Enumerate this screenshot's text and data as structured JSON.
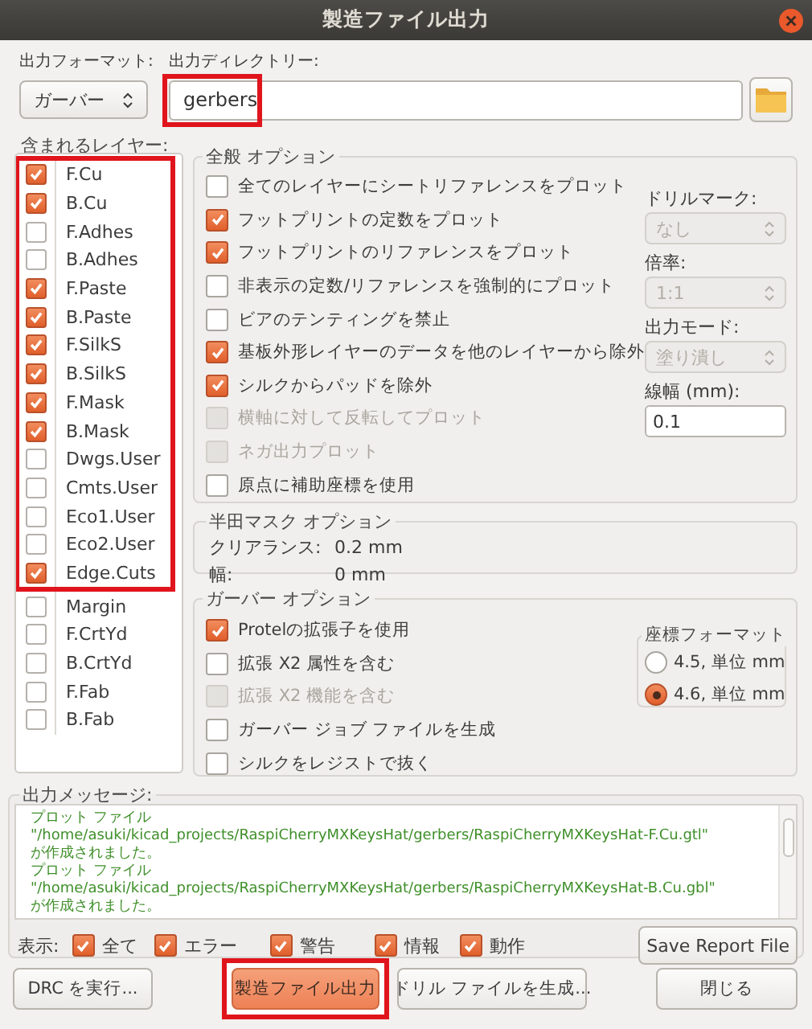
{
  "window": {
    "title": "製造ファイル出力"
  },
  "output_format": {
    "label": "出力フォーマット:",
    "value": "ガーバー"
  },
  "output_directory": {
    "label": "出力ディレクトリー:",
    "value": "gerbers",
    "highlighted": true
  },
  "layers": {
    "label": "含まれるレイヤー:",
    "groups": [
      {
        "highlighted": true,
        "items": [
          {
            "name": "F.Cu",
            "checked": true
          },
          {
            "name": "B.Cu",
            "checked": true
          },
          {
            "name": "F.Adhes",
            "checked": false
          },
          {
            "name": "B.Adhes",
            "checked": false
          },
          {
            "name": "F.Paste",
            "checked": true
          },
          {
            "name": "B.Paste",
            "checked": true
          },
          {
            "name": "F.SilkS",
            "checked": true
          },
          {
            "name": "B.SilkS",
            "checked": true
          },
          {
            "name": "F.Mask",
            "checked": true
          },
          {
            "name": "B.Mask",
            "checked": true
          },
          {
            "name": "Dwgs.User",
            "checked": false
          },
          {
            "name": "Cmts.User",
            "checked": false
          },
          {
            "name": "Eco1.User",
            "checked": false
          },
          {
            "name": "Eco2.User",
            "checked": false
          },
          {
            "name": "Edge.Cuts",
            "checked": true
          }
        ]
      },
      {
        "highlighted": false,
        "items": [
          {
            "name": "Margin",
            "checked": false
          },
          {
            "name": "F.CrtYd",
            "checked": false
          },
          {
            "name": "B.CrtYd",
            "checked": false
          },
          {
            "name": "F.Fab",
            "checked": false
          },
          {
            "name": "B.Fab",
            "checked": false
          }
        ]
      }
    ]
  },
  "general_options": {
    "title": "全般 オプション",
    "options": [
      {
        "label": "全てのレイヤーにシートリファレンスをプロット",
        "checked": false,
        "disabled": false
      },
      {
        "label": "フットプリントの定数をプロット",
        "checked": true,
        "disabled": false
      },
      {
        "label": "フットプリントのリファレンスをプロット",
        "checked": true,
        "disabled": false
      },
      {
        "label": "非表示の定数/リファレンスを強制的にプロット",
        "checked": false,
        "disabled": false
      },
      {
        "label": "ビアのテンティングを禁止",
        "checked": false,
        "disabled": false
      },
      {
        "label": "基板外形レイヤーのデータを他のレイヤーから除外",
        "checked": true,
        "disabled": false
      },
      {
        "label": "シルクからパッドを除外",
        "checked": true,
        "disabled": false
      },
      {
        "label": "横軸に対して反転してプロット",
        "checked": false,
        "disabled": true
      },
      {
        "label": "ネガ出力プロット",
        "checked": false,
        "disabled": true
      },
      {
        "label": "原点に補助座標を使用",
        "checked": false,
        "disabled": false
      }
    ],
    "settings": [
      {
        "kind": "select",
        "label": "ドリルマーク:",
        "value": "なし",
        "disabled": true
      },
      {
        "kind": "select",
        "label": "倍率:",
        "value": "1:1",
        "disabled": true
      },
      {
        "kind": "select",
        "label": "出力モード:",
        "value": "塗り潰し",
        "disabled": true
      },
      {
        "kind": "input",
        "label": "線幅 (mm):",
        "value": "0.1",
        "disabled": false
      }
    ]
  },
  "solder_mask_options": {
    "title": "半田マスク オプション",
    "rows": [
      {
        "label": "クリアランス:",
        "value": "0.2 mm"
      },
      {
        "label": "幅:",
        "value": "0 mm"
      }
    ]
  },
  "gerber_options": {
    "title": "ガーバー オプション",
    "options": [
      {
        "label": "Protelの拡張子を使用",
        "checked": true,
        "disabled": false
      },
      {
        "label": "拡張 X2 属性を含む",
        "checked": false,
        "disabled": false
      },
      {
        "label": "拡張 X2 機能を含む",
        "checked": false,
        "disabled": true
      },
      {
        "label": "ガーバー ジョブ ファイルを生成",
        "checked": false,
        "disabled": false
      },
      {
        "label": "シルクをレジストで抜く",
        "checked": false,
        "disabled": false
      }
    ],
    "coordinate_format": {
      "title": "座標フォーマット",
      "choices": [
        {
          "label": "4.5, 単位 mm",
          "selected": false
        },
        {
          "label": "4.6, 単位 mm",
          "selected": true
        }
      ]
    }
  },
  "messages": {
    "label": "出力メッセージ:",
    "lines": [
      "プロット ファイル",
      "\"/home/asuki/kicad_projects/RaspiCherryMXKeysHat/gerbers/RaspiCherryMXKeysHat-F.Cu.gtl\"",
      "が作成されました。",
      "プロット ファイル",
      "\"/home/asuki/kicad_projects/RaspiCherryMXKeysHat/gerbers/RaspiCherryMXKeysHat-B.Cu.gbl\"",
      "が作成されました。"
    ]
  },
  "filters": {
    "label": "表示:",
    "items": [
      {
        "label": "全て",
        "checked": true
      },
      {
        "label": "エラー",
        "checked": true
      },
      {
        "label": "警告",
        "checked": true
      },
      {
        "label": "情報",
        "checked": true
      },
      {
        "label": "動作",
        "checked": true
      }
    ]
  },
  "save_report_button": "Save Report File",
  "buttons": [
    {
      "label": "DRC を実行...",
      "primary": false,
      "highlighted": false
    },
    {
      "label": "製造ファイル出力",
      "primary": true,
      "highlighted": true
    },
    {
      "label": "ドリル ファイルを生成...",
      "primary": false,
      "highlighted": false
    },
    {
      "label": "閉じる",
      "primary": false,
      "highlighted": false
    }
  ]
}
